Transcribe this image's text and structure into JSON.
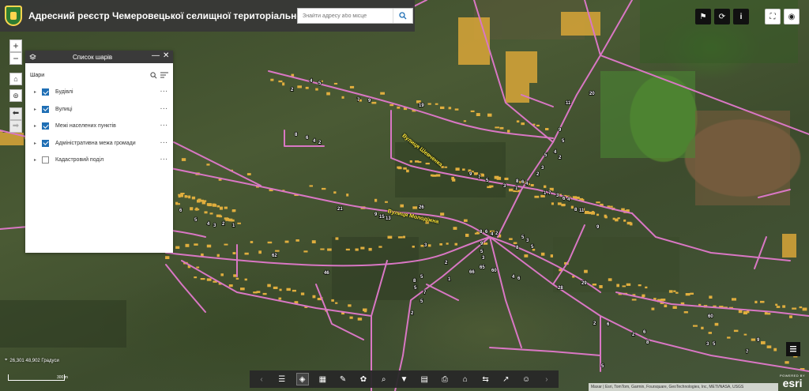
{
  "header": {
    "title": "Адресний реєстр Чемеровецької селищної територіальної громади",
    "search_placeholder": "Знайти адресу або місце"
  },
  "zoom": {
    "in_label": "+",
    "out_label": "−"
  },
  "layer_panel": {
    "title": "Список шарів",
    "section_label": "Шари",
    "layers": [
      {
        "label": "Будівлі",
        "checked": true
      },
      {
        "label": "Вулиці",
        "checked": true
      },
      {
        "label": "Межі населених пунктів",
        "checked": true
      },
      {
        "label": "Адміністративна межа громади",
        "checked": true
      },
      {
        "label": "Кадастровий поділ",
        "checked": false
      }
    ]
  },
  "map": {
    "street_labels": [
      "Вулиця Шевченка",
      "Вулиця Молодіжна"
    ],
    "house_numbers": [
      "2",
      "4",
      "5",
      "7",
      "9",
      "19",
      "11",
      "20",
      "6",
      "8",
      "6",
      "4",
      "2",
      "9",
      "5",
      "3",
      "4",
      "2",
      "9",
      "7",
      "5",
      "3",
      "1",
      "8",
      "6",
      "4",
      "2",
      "1",
      "7",
      "3",
      "6",
      "4",
      "11",
      "8",
      "9",
      "21",
      "9",
      "15",
      "13",
      "26",
      "6",
      "5",
      "4",
      "3",
      "2",
      "1",
      "62",
      "46",
      "8",
      "6",
      "4",
      "2",
      "9",
      "5",
      "3",
      "6",
      "4",
      "2",
      "5",
      "3",
      "8",
      "5",
      "1",
      "66",
      "65",
      "60",
      "9",
      "7",
      "5",
      "3",
      "2",
      "6",
      "4",
      "8",
      "29",
      "28",
      "60",
      "2",
      "4",
      "6",
      "8",
      "5",
      "3",
      "2",
      "7",
      "9",
      "11"
    ],
    "coordinates": "26,301 48,902 Градуси",
    "scale_label": "300 m",
    "attribution": "Maxar | Esri, TomTom, Garmin, Foursquare, GeoTechnologies, Inc, METI/NASA, USGS",
    "esri_powered": "POWERED BY",
    "esri_name": "esri"
  },
  "colors": {
    "road": "#d977c4",
    "building": "#d9a638",
    "accent": "#1f6fb5",
    "header_bg": "#373737"
  },
  "toolbar_icons": [
    "chevron-left-icon",
    "legend-list-icon",
    "layers-icon",
    "basemap-grid-icon",
    "draw-pencil-icon",
    "analysis-icon",
    "query-icon",
    "filter-icon",
    "report-icon",
    "print-icon",
    "home-icon",
    "swipe-icon",
    "share-icon",
    "about-icon",
    "chevron-right-icon"
  ]
}
